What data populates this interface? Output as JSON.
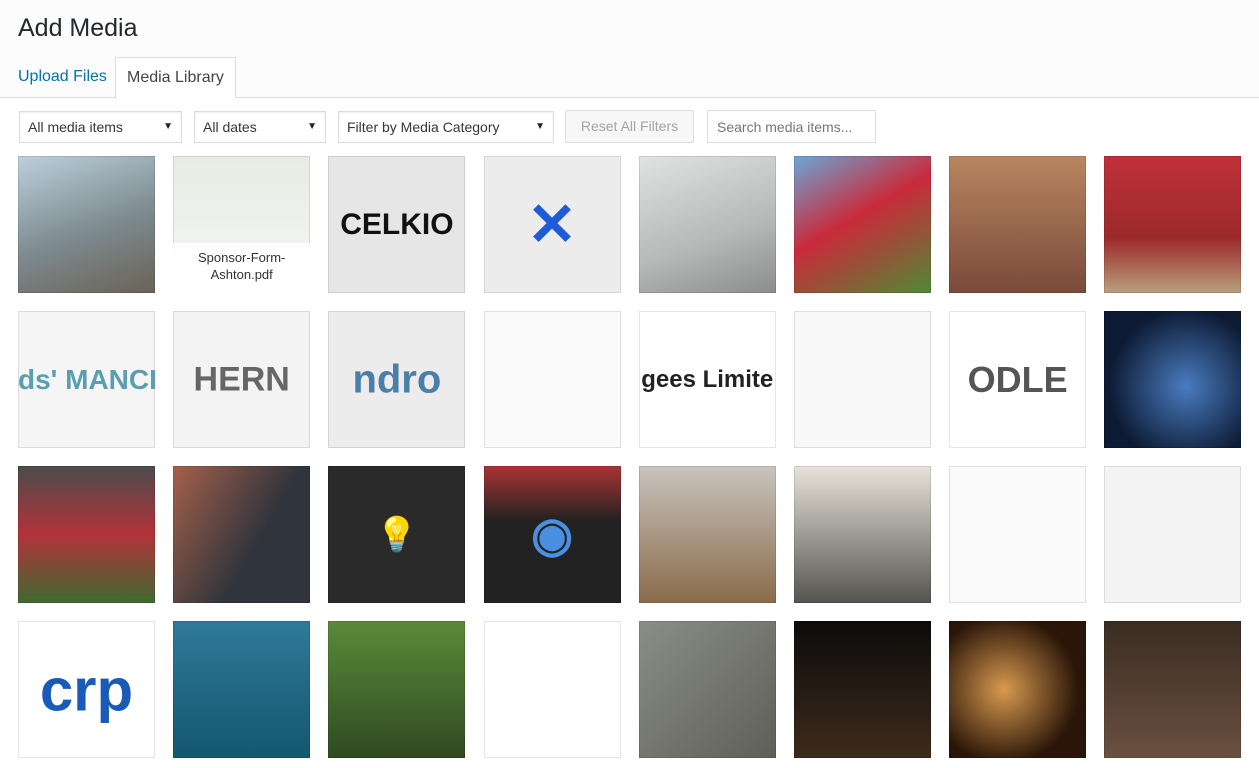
{
  "header": {
    "title": "Add Media"
  },
  "tabs": [
    {
      "label": "Upload Files",
      "active": false
    },
    {
      "label": "Media Library",
      "active": true
    }
  ],
  "toolbar": {
    "media_type": "All media items",
    "dates": "All dates",
    "category": "Filter by Media Category",
    "reset_label": "Reset All Filters",
    "search_placeholder": "Search media items..."
  },
  "colors": {
    "link": "#0073aa",
    "border": "#dddddd"
  },
  "tiles": [
    {
      "bg": "linear-gradient(160deg,#bcd0dc,#7d8a8f 55%,#6a6256)"
    },
    {
      "bg": "linear-gradient(#e8ece4,#f6f6f6)",
      "caption": "Sponsor-Form-Ashton.pdf"
    },
    {
      "bg": "#e6e6e6",
      "text": "CELKIO",
      "tc": "#111",
      "ts": "30px"
    },
    {
      "bg": "#ececec",
      "text": "✕",
      "tc": "#1f5bd6",
      "ts": "60px"
    },
    {
      "bg": "linear-gradient(160deg,#dfe4e2,#b4b8b6 60%,#8c8c8c)"
    },
    {
      "bg": "linear-gradient(150deg,#6aa6d8,#c92a3a 45%,#4f8a35)"
    },
    {
      "bg": "linear-gradient(#b98660,#7a4a3a)"
    },
    {
      "bg": "linear-gradient(#c0303a,#9b2a2a 60%,#b8a07c)"
    },
    {
      "bg": "#f5f5f5",
      "text": "ds' MANCH",
      "tc": "#5a9fb0",
      "ts": "28px"
    },
    {
      "bg": "#f3f3f3",
      "text": "HERN",
      "tc": "#666",
      "ts": "34px"
    },
    {
      "bg": "#ececec",
      "text": "ndro",
      "tc": "#4a7fa8",
      "ts": "40px"
    },
    {
      "bg": "#fafafa"
    },
    {
      "bg": "#ffffff",
      "text": "gees Limite",
      "tc": "#222",
      "ts": "24px"
    },
    {
      "bg": "#f8f8f8"
    },
    {
      "bg": "#ffffff",
      "text": "ODLE",
      "tc": "#555",
      "ts": "36px"
    },
    {
      "bg": "radial-gradient(circle at 60% 55%,#4a7cc0,#0c1a33 70%)"
    },
    {
      "bg": "linear-gradient(#4b4b4b,#b2333a 50%,#3e6a30)"
    },
    {
      "bg": "linear-gradient(120deg,#a5604a,#30343c 60%)"
    },
    {
      "bg": "#2a2a2a",
      "text": "💡",
      "tc": "#ddd",
      "ts": "34px"
    },
    {
      "bg": "linear-gradient(#a33,#222 40%)",
      "text": "◉",
      "tc": "#4a90e2",
      "ts": "48px"
    },
    {
      "bg": "linear-gradient(#c9c4be,#8a6a4a)"
    },
    {
      "bg": "linear-gradient(#e8e3da,#54544f)"
    },
    {
      "bg": "#fafafa"
    },
    {
      "bg": "#f4f4f4"
    },
    {
      "bg": "#ffffff",
      "text": "crp",
      "tc": "#1a5bb8",
      "ts": "60px"
    },
    {
      "bg": "linear-gradient(#2f7a9a,#14566f)"
    },
    {
      "bg": "linear-gradient(#5b8a3a,#2f4a20)"
    },
    {
      "bg": "#ffffff"
    },
    {
      "bg": "linear-gradient(135deg,#8b8e84,#5e6058)"
    },
    {
      "bg": "linear-gradient(#0c0c0c,#3d2a1a)"
    },
    {
      "bg": "radial-gradient(circle at 40% 50%,#d89a50,#2a1508 70%)"
    },
    {
      "bg": "linear-gradient(#3a2c22,#6a5040)"
    }
  ]
}
